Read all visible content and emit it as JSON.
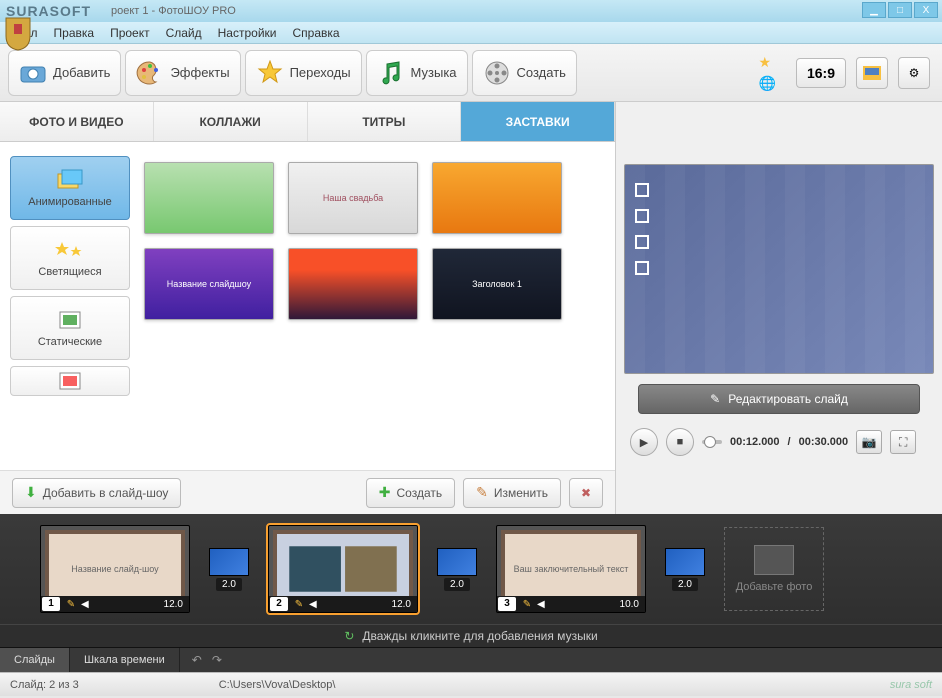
{
  "title": {
    "brand": "SURASOFT",
    "window": "роект 1 - ФотоШОУ PRO"
  },
  "win_controls": {
    "min": "▁",
    "max": "□",
    "close": "X"
  },
  "menubar": [
    "Файл",
    "Правка",
    "Проект",
    "Слайд",
    "Настройки",
    "Справка"
  ],
  "toolbar": {
    "add": "Добавить",
    "effects": "Эффекты",
    "transitions": "Переходы",
    "music": "Музыка",
    "create": "Создать",
    "ratio": "16:9"
  },
  "cats": {
    "photo": "ФОТО И ВИДЕО",
    "collage": "КОЛЛАЖИ",
    "titles": "ТИТРЫ",
    "intros": "ЗАСТАВКИ"
  },
  "side_cats": {
    "animated": "Анимированные",
    "glowing": "Светящиеся",
    "static": "Статические"
  },
  "thumbs": {
    "t1": "",
    "t2": "Наша свадьба",
    "t3": "",
    "t4": "Название слайдшоу",
    "t5": "",
    "t6": "Заголовок 1"
  },
  "actions": {
    "add_slideshow": "Добавить в слайд-шоу",
    "create": "Создать",
    "edit": "Изменить"
  },
  "preview": {
    "edit_slide": "Редактировать слайд",
    "time_cur": "00:12.000",
    "time_tot": "00:30.000"
  },
  "timeline": {
    "slides": [
      {
        "num": "1",
        "label": "Название слайд-шоу",
        "dur": "12.0"
      },
      {
        "num": "2",
        "label": "",
        "dur": "12.0"
      },
      {
        "num": "3",
        "label": "Ваш заключительный текст",
        "dur": "10.0"
      }
    ],
    "trans_dur": "2.0",
    "add_photo": "Добавьте фото",
    "music_hint": "Дважды кликните для добавления музыки",
    "tab_slides": "Слайды",
    "tab_timeline": "Шкала времени"
  },
  "status": {
    "slide_info": "Слайд: 2 из 3",
    "path": "C:\\Users\\Vova\\Desktop\\",
    "watermark": "sura soft"
  }
}
